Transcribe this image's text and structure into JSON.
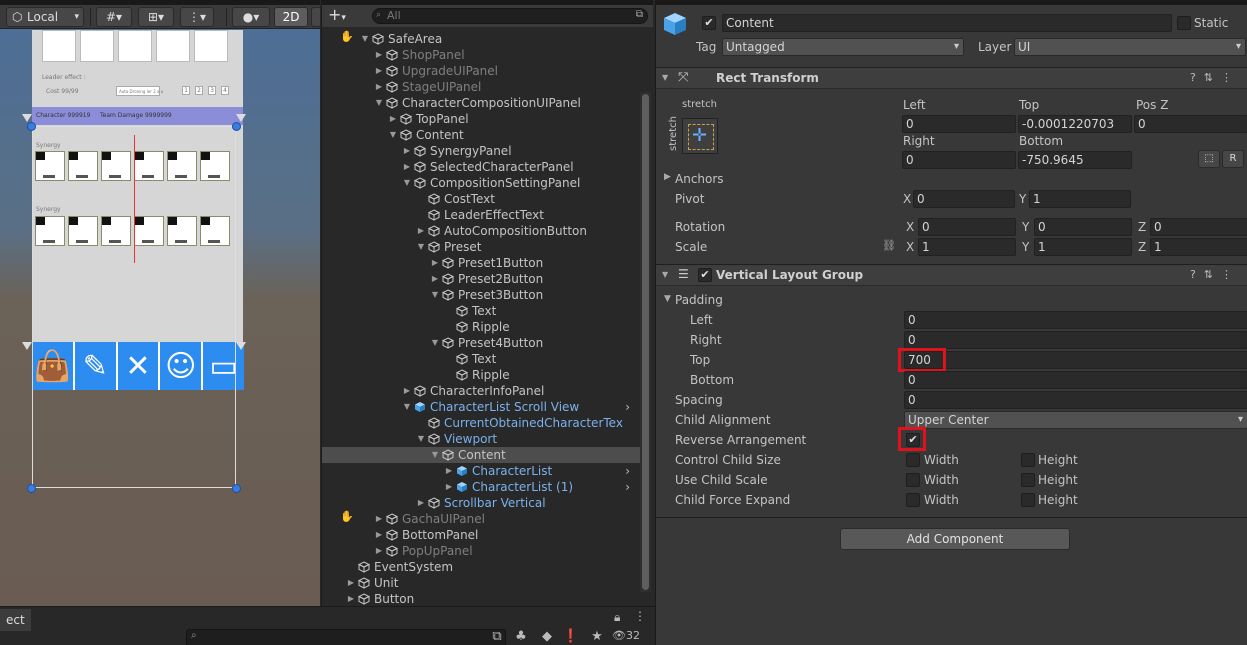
{
  "scene": {
    "pivot_mode": "Local",
    "mode_2d": "2D",
    "game_texts": {
      "leader_effect": "Leader effect :",
      "cost": "Cost 99/99",
      "auto_button": "Auto Droning ler 2 a a",
      "preset_buttons": [
        "1",
        "2",
        "3",
        "4"
      ],
      "character_label": "Character 999919",
      "team_damage": "Team Damage 9999999",
      "synergy_1": "Synergy",
      "synergy_2": "Synergy"
    },
    "nav_icons": [
      "shop-bag-icon",
      "brush-icon",
      "close-x-icon",
      "user-icon",
      "card-icon"
    ]
  },
  "project_bar": {
    "tab_label": "ect",
    "visible_count": "32"
  },
  "hierarchy": {
    "search_placeholder": "All",
    "items": [
      {
        "label": "SafeArea",
        "depth": 2,
        "arrow": "down",
        "style": "normal"
      },
      {
        "label": "ShopPanel",
        "depth": 3,
        "arrow": "right",
        "style": "dim"
      },
      {
        "label": "UpgradeUIPanel",
        "depth": 3,
        "arrow": "right",
        "style": "dim"
      },
      {
        "label": "StageUIPanel",
        "depth": 3,
        "arrow": "right",
        "style": "dim"
      },
      {
        "label": "CharacterCompositionUIPanel",
        "depth": 3,
        "arrow": "down",
        "style": "normal"
      },
      {
        "label": "TopPanel",
        "depth": 4,
        "arrow": "right",
        "style": "normal"
      },
      {
        "label": "Content",
        "depth": 4,
        "arrow": "down",
        "style": "normal"
      },
      {
        "label": "SynergyPanel",
        "depth": 5,
        "arrow": "right",
        "style": "normal"
      },
      {
        "label": "SelectedCharacterPanel",
        "depth": 5,
        "arrow": "right",
        "style": "normal"
      },
      {
        "label": "CompositionSettingPanel",
        "depth": 5,
        "arrow": "down",
        "style": "normal"
      },
      {
        "label": "CostText",
        "depth": 6,
        "arrow": "",
        "style": "normal"
      },
      {
        "label": "LeaderEffectText",
        "depth": 6,
        "arrow": "",
        "style": "normal"
      },
      {
        "label": "AutoCompositionButton",
        "depth": 6,
        "arrow": "right",
        "style": "normal"
      },
      {
        "label": "Preset",
        "depth": 6,
        "arrow": "down",
        "style": "normal"
      },
      {
        "label": "Preset1Button",
        "depth": 7,
        "arrow": "right",
        "style": "normal"
      },
      {
        "label": "Preset2Button",
        "depth": 7,
        "arrow": "right",
        "style": "normal"
      },
      {
        "label": "Preset3Button",
        "depth": 7,
        "arrow": "down",
        "style": "normal"
      },
      {
        "label": "Text",
        "depth": 8,
        "arrow": "",
        "style": "normal"
      },
      {
        "label": "Ripple",
        "depth": 8,
        "arrow": "",
        "style": "normal"
      },
      {
        "label": "Preset4Button",
        "depth": 7,
        "arrow": "down",
        "style": "normal"
      },
      {
        "label": "Text",
        "depth": 8,
        "arrow": "",
        "style": "normal"
      },
      {
        "label": "Ripple",
        "depth": 8,
        "arrow": "",
        "style": "normal"
      },
      {
        "label": "CharacterInfoPanel",
        "depth": 5,
        "arrow": "right",
        "style": "normal"
      },
      {
        "label": "CharacterList Scroll View",
        "depth": 5,
        "arrow": "down",
        "style": "blue",
        "prefab": true
      },
      {
        "label": "CurrentObtainedCharacterTex",
        "depth": 6,
        "arrow": "",
        "style": "blue"
      },
      {
        "label": "Viewport",
        "depth": 6,
        "arrow": "down",
        "style": "blue"
      },
      {
        "label": "Content",
        "depth": 7,
        "arrow": "down",
        "style": "selected"
      },
      {
        "label": "CharacterList",
        "depth": 8,
        "arrow": "right",
        "style": "blue",
        "prefab": true
      },
      {
        "label": "CharacterList (1)",
        "depth": 8,
        "arrow": "right",
        "style": "blue",
        "prefab": true
      },
      {
        "label": "Scrollbar Vertical",
        "depth": 6,
        "arrow": "right",
        "style": "blue"
      },
      {
        "label": "GachaUIPanel",
        "depth": 3,
        "arrow": "right",
        "style": "dim"
      },
      {
        "label": "BottomPanel",
        "depth": 3,
        "arrow": "right",
        "style": "normal"
      },
      {
        "label": "PopUpPanel",
        "depth": 3,
        "arrow": "right",
        "style": "dim"
      },
      {
        "label": "EventSystem",
        "depth": 1,
        "arrow": "",
        "style": "normal"
      },
      {
        "label": "Unit",
        "depth": 1,
        "arrow": "right",
        "style": "normal"
      },
      {
        "label": "Button",
        "depth": 1,
        "arrow": "right",
        "style": "normal"
      }
    ]
  },
  "inspector": {
    "object_name": "Content",
    "static_label": "Static",
    "tag_label": "Tag",
    "tag_value": "Untagged",
    "layer_label": "Layer",
    "layer_value": "UI",
    "rect_transform": {
      "title": "Rect Transform",
      "stretch_h": "stretch",
      "stretch_v": "stretch",
      "left_label": "Left",
      "left": "0",
      "top_label": "Top",
      "top": "-0.0001220703",
      "posz_label": "Pos Z",
      "posz": "0",
      "right_label": "Right",
      "right": "0",
      "bottom_label": "Bottom",
      "bottom": "-750.9645",
      "r_button": "R",
      "anchors_label": "Anchors",
      "pivot_label": "Pivot",
      "pivot_x": "0",
      "pivot_y": "1",
      "rotation_label": "Rotation",
      "rot_x": "0",
      "rot_y": "0",
      "rot_z": "0",
      "scale_label": "Scale",
      "scale_x": "1",
      "scale_y": "1",
      "scale_z": "1",
      "x": "X",
      "y": "Y",
      "z": "Z"
    },
    "vlg": {
      "title": "Vertical Layout Group",
      "padding_label": "Padding",
      "left_label": "Left",
      "left": "0",
      "right_label": "Right",
      "right": "0",
      "top_label": "Top",
      "top": "700",
      "bottom_label": "Bottom",
      "bottom": "0",
      "spacing_label": "Spacing",
      "spacing": "0",
      "child_alignment_label": "Child Alignment",
      "child_alignment": "Upper Center",
      "reverse_label": "Reverse Arrangement",
      "control_size_label": "Control Child Size",
      "use_scale_label": "Use Child Scale",
      "force_expand_label": "Child Force Expand",
      "width": "Width",
      "height": "Height"
    },
    "add_component": "Add Component"
  }
}
